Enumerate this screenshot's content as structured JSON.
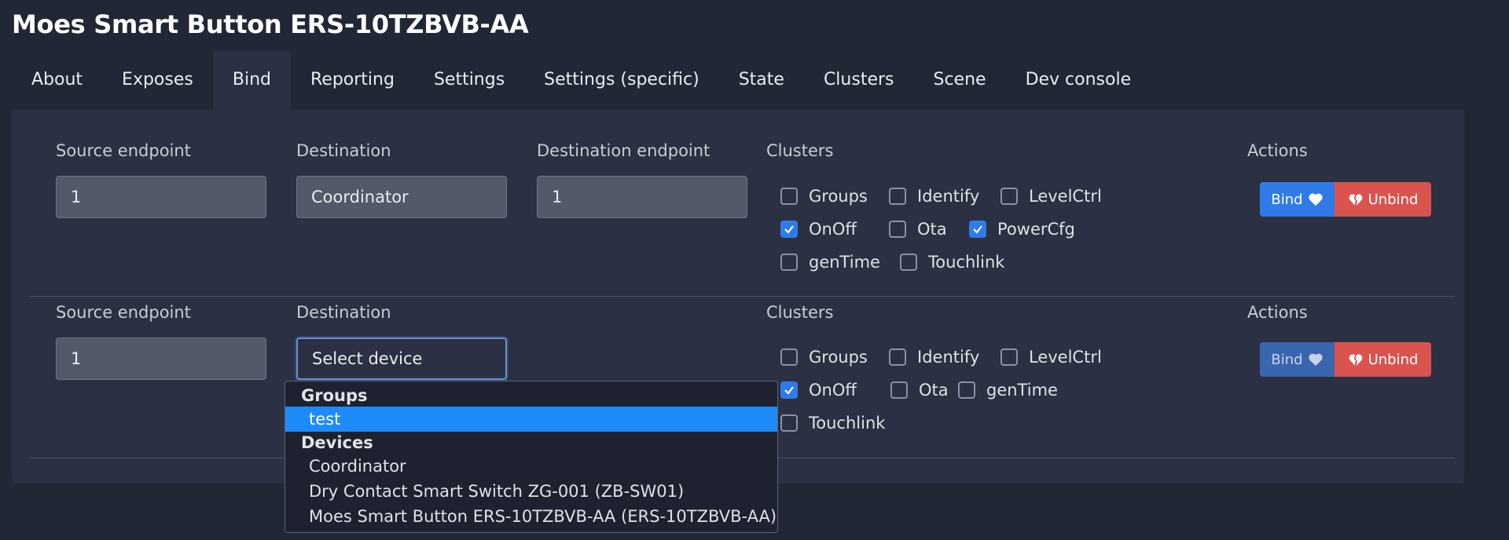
{
  "page_title": "Moes Smart Button ERS-10TZBVB-AA",
  "tabs": [
    "About",
    "Exposes",
    "Bind",
    "Reporting",
    "Settings",
    "Settings (specific)",
    "State",
    "Clusters",
    "Scene",
    "Dev console"
  ],
  "active_tab": "Bind",
  "headers": {
    "source_endpoint": "Source endpoint",
    "destination": "Destination",
    "destination_endpoint": "Destination endpoint",
    "clusters": "Clusters",
    "actions": "Actions"
  },
  "rows": [
    {
      "source_endpoint": "1",
      "destination": "Coordinator",
      "destination_endpoint": "1",
      "clusters": [
        {
          "label": "Groups",
          "checked": false
        },
        {
          "label": "Identify",
          "checked": false
        },
        {
          "label": "LevelCtrl",
          "checked": false
        },
        {
          "label": "OnOff",
          "checked": true
        },
        {
          "label": "Ota",
          "checked": false
        },
        {
          "label": "PowerCfg",
          "checked": true
        },
        {
          "label": "genTime",
          "checked": false
        },
        {
          "label": "Touchlink",
          "checked": false
        }
      ],
      "bind_label": "Bind",
      "unbind_label": "Unbind"
    },
    {
      "source_endpoint": "1",
      "destination_placeholder": "Select device",
      "clusters": [
        {
          "label": "Groups",
          "checked": false
        },
        {
          "label": "Identify",
          "checked": false
        },
        {
          "label": "LevelCtrl",
          "checked": false
        },
        {
          "label": "OnOff",
          "checked": true
        },
        {
          "label": "Ota",
          "checked": false
        },
        {
          "label": "genTime",
          "checked": false
        },
        {
          "label": "Touchlink",
          "checked": false
        }
      ],
      "bind_label": "Bind",
      "unbind_label": "Unbind"
    }
  ],
  "dropdown": {
    "groups_header": "Groups",
    "groups": [
      "test"
    ],
    "selected": "test",
    "devices_header": "Devices",
    "devices": [
      "Coordinator",
      "Dry Contact Smart Switch ZG-001 (ZB-SW01)",
      "Moes Smart Button ERS-10TZBVB-AA (ERS-10TZBVB-AA)"
    ]
  },
  "colors": {
    "background": "#222735",
    "panel": "#2b3142",
    "primary": "#2f7ce8",
    "danger": "#d9534f",
    "dropdown_highlight": "#1e8bfa"
  }
}
